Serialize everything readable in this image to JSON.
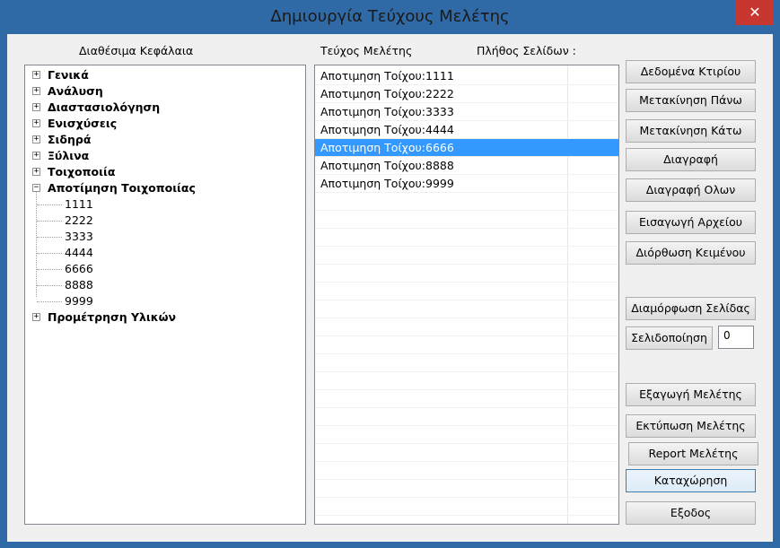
{
  "window": {
    "title": "Δημιουργία Τεύχους Μελέτης",
    "close_glyph": "✕"
  },
  "left_panel": {
    "header": "Διαθέσιμα Κεφάλαια",
    "tree": [
      {
        "label": "Γενικά",
        "expander": "+"
      },
      {
        "label": "Ανάλυση",
        "expander": "+"
      },
      {
        "label": "Διαστασιολόγηση",
        "expander": "+"
      },
      {
        "label": "Ενισχύσεις",
        "expander": "+"
      },
      {
        "label": "Σιδηρά",
        "expander": "+"
      },
      {
        "label": "Ξύλινα",
        "expander": "+"
      },
      {
        "label": "Τοιχοποιία",
        "expander": "+"
      },
      {
        "label": "Αποτίμηση Τοιχοποιίας",
        "expander": "−",
        "children": [
          "1111",
          "2222",
          "3333",
          "4444",
          "6666",
          "8888",
          "9999"
        ]
      },
      {
        "label": "Προμέτρηση Υλικών",
        "expander": "+"
      }
    ]
  },
  "right_panel": {
    "header": "Τεύχος Μελέτης",
    "pages_header": "Πλήθος Σελίδων :",
    "items": [
      "Αποτιμηση Τοίχου:1111",
      "Αποτιμηση Τοίχου:2222",
      "Αποτιμηση Τοίχου:3333",
      "Αποτιμηση Τοίχου:4444",
      "Αποτιμηση Τοίχου:6666",
      "Αποτιμηση Τοίχου:8888",
      "Αποτιμηση Τοίχου:9999"
    ],
    "selected_index": 4
  },
  "buttons": {
    "building_data": "Δεδομένα Κτιρίου",
    "move_up": "Μετακίνηση Πάνω",
    "move_down": "Μετακίνηση Κάτω",
    "delete": "Διαγραφή",
    "delete_all": "Διαγραφή Ολων",
    "import_file": "Εισαγωγή Αρχείου",
    "edit_text": "Διόρθωση Κειμένου",
    "page_setup": "Διαμόρφωση Σελίδας",
    "paginate": "Σελιδοποίηση",
    "export": "Εξαγωγή Μελέτης",
    "print": "Εκτύπωση Μελέτης",
    "report": "Report Μελέτης",
    "save": "Καταχώρηση",
    "exit": "Εξοδος"
  },
  "pagination_value": "0"
}
